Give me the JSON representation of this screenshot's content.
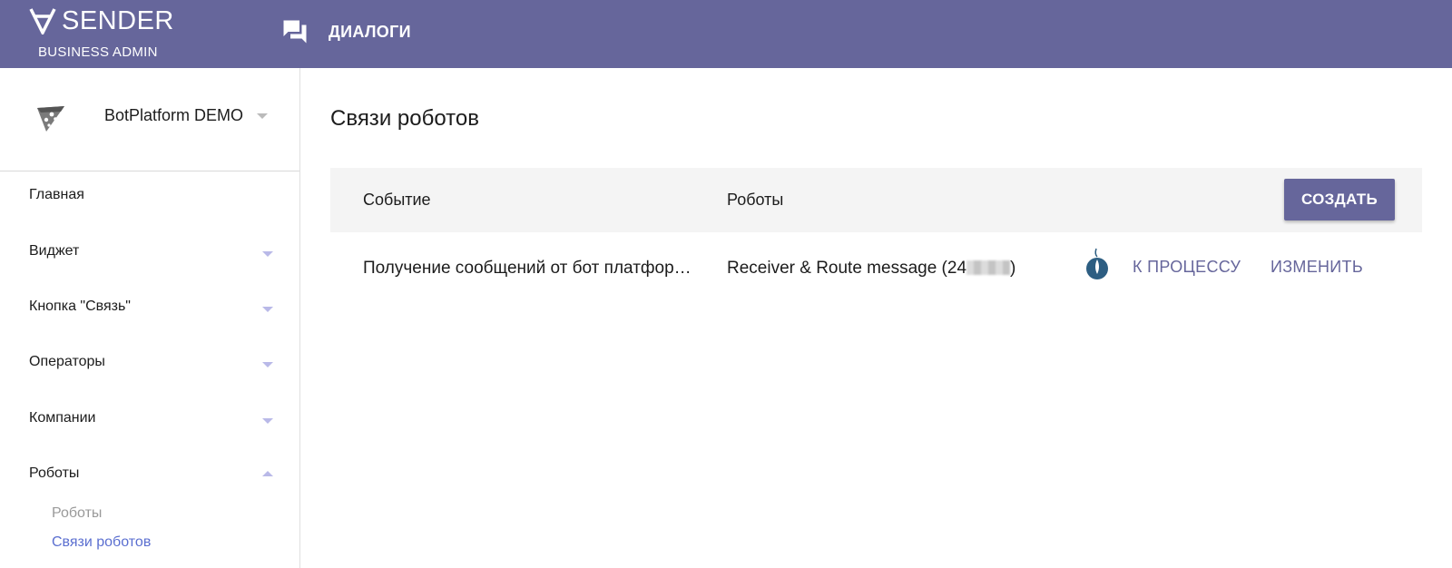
{
  "header": {
    "brand": "SENDER",
    "brand_sub": "BUSINESS ADMIN",
    "nav_dialogs": "ДИАЛОГИ",
    "background_color": "#66669b"
  },
  "sidebar": {
    "org_name": "BotPlatform DEMO",
    "items": [
      {
        "label": "Главная"
      },
      {
        "label": "Виджет"
      },
      {
        "label": "Кнопка \"Связь\""
      },
      {
        "label": "Операторы"
      },
      {
        "label": "Компании"
      },
      {
        "label": "Роботы"
      }
    ],
    "sub_items": [
      {
        "label": "Роботы"
      },
      {
        "label": "Связи роботов"
      }
    ],
    "active_color": "#5b6fd0"
  },
  "main": {
    "title": "Связи роботов",
    "table": {
      "col_event": "Событие",
      "col_robots": "Роботы",
      "create_label": "СОЗДАТЬ",
      "rows": [
        {
          "event": "Получение сообщений от бот платформы",
          "robot_prefix": "Receiver & Route message (24",
          "robot_suffix": ")",
          "to_process": "К ПРОЦЕССУ",
          "edit": "ИЗМЕНИТЬ"
        }
      ]
    }
  }
}
